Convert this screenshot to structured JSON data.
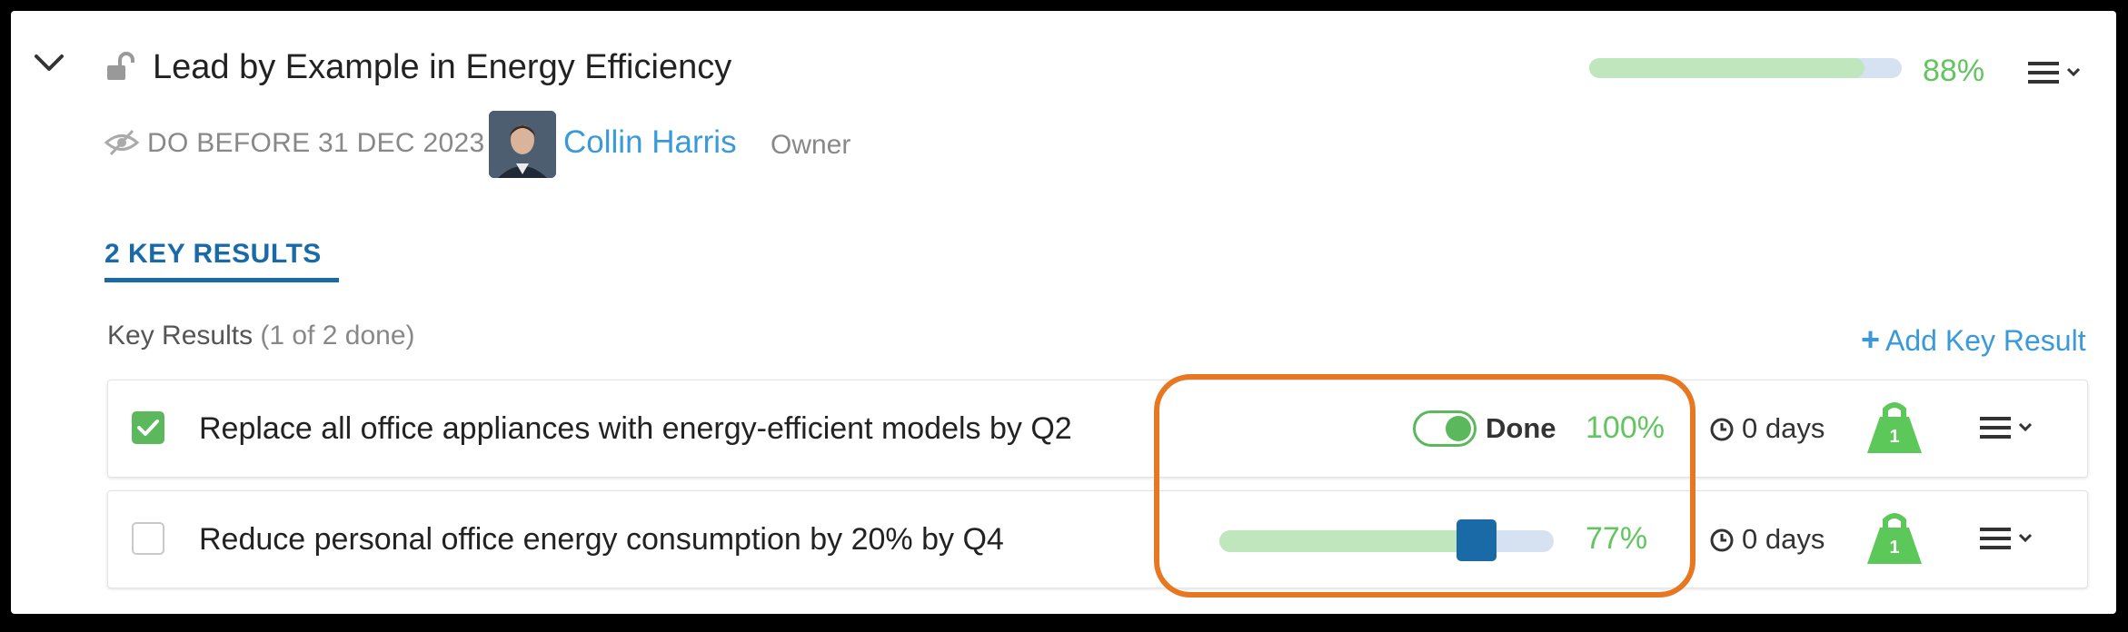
{
  "objective": {
    "title": "Lead by Example in Energy Efficiency",
    "progress_pct": 88,
    "progress_text": "88%",
    "deadline": "DO BEFORE 31 DEC 2023",
    "owner_name": "Collin Harris",
    "owner_role": "Owner"
  },
  "tabs": [
    {
      "label": "2 KEY RESULTS",
      "active": true
    }
  ],
  "key_results": {
    "heading": "Key Results",
    "summary": "(1 of 2 done)",
    "add_plus": "+",
    "add_label": "Add Key Result",
    "items": [
      {
        "title": "Replace all office appliances with energy-efficient models by Q2",
        "checked": true,
        "status_label": "Done",
        "progress_pct": 100,
        "progress_text": "100%",
        "days": "0 days",
        "weight": "1"
      },
      {
        "title": "Reduce personal office energy consumption by 20% by Q4",
        "checked": false,
        "progress_pct": 77,
        "progress_text": "77%",
        "days": "0 days",
        "weight": "1"
      }
    ]
  },
  "icons": {
    "collapse": "chevron-down-icon",
    "lock": "unlock-icon",
    "visibility": "eye-slash-icon",
    "menu": "hamburger-menu-icon",
    "clock": "clock-icon",
    "weight": "kettlebell-weight-icon",
    "add": "plus-icon"
  },
  "colors": {
    "accent_blue": "#1a6aa8",
    "link_blue": "#3a9ad9",
    "progress_green": "#62c560",
    "checkbox_green": "#5cb85c",
    "progress_fill": "#bfe6bd",
    "track_blue": "#d6e2f2",
    "highlight_orange": "#e87722"
  }
}
